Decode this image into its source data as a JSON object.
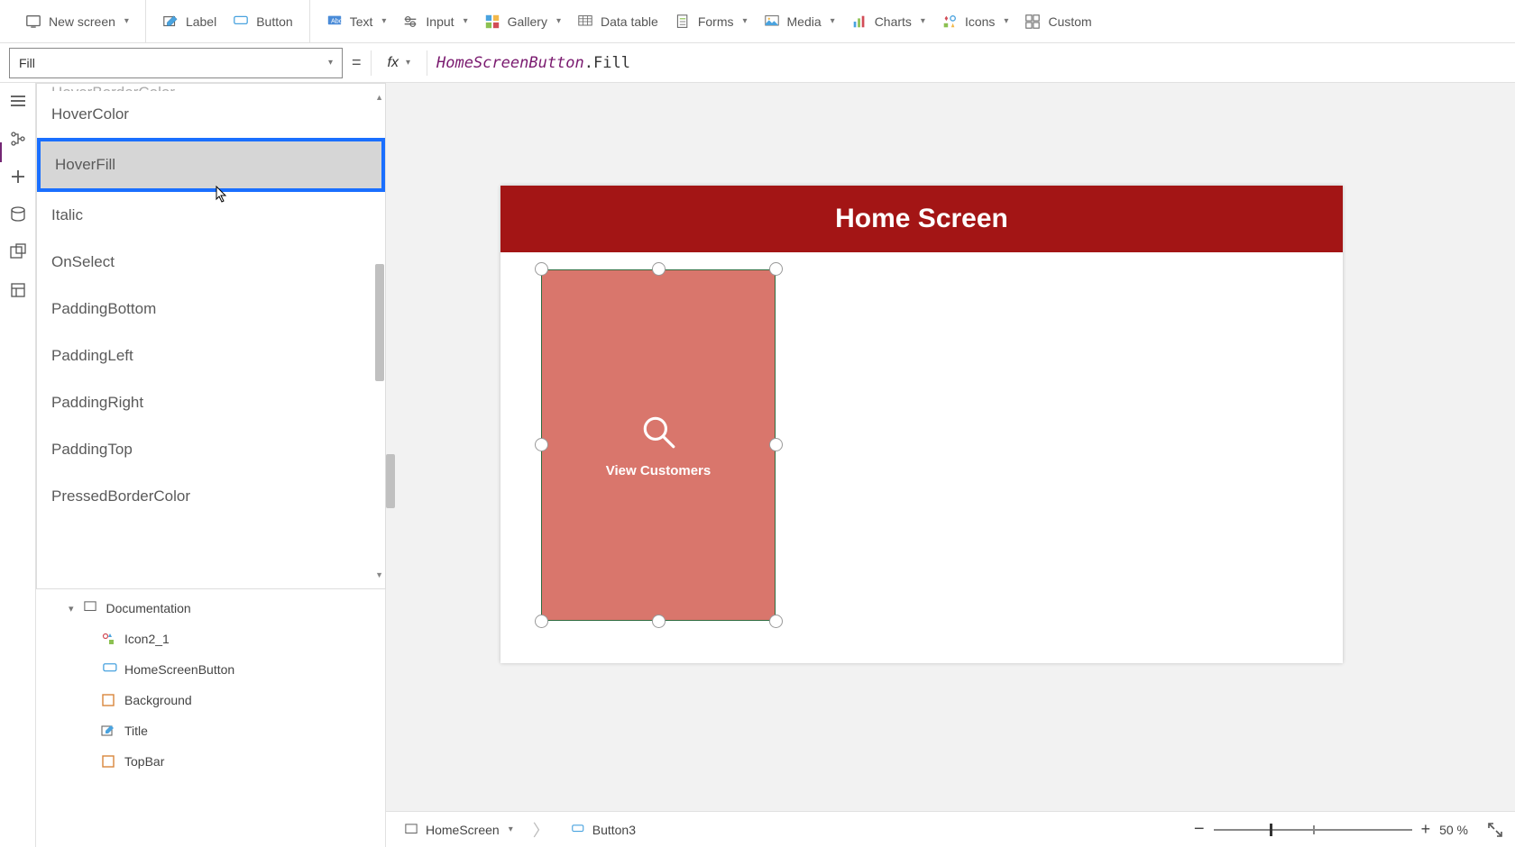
{
  "ribbon": {
    "new_screen": "New screen",
    "label": "Label",
    "button": "Button",
    "text": "Text",
    "input": "Input",
    "gallery": "Gallery",
    "data_table": "Data table",
    "forms": "Forms",
    "media": "Media",
    "charts": "Charts",
    "icons": "Icons",
    "custom": "Custom"
  },
  "formula_bar": {
    "property_selected": "Fill",
    "control_ref": "HomeScreenButton",
    "property_ref": ".Fill"
  },
  "property_dropdown": {
    "items": [
      "HoverBorderColor",
      "HoverColor",
      "HoverFill",
      "Italic",
      "OnSelect",
      "PaddingBottom",
      "PaddingLeft",
      "PaddingRight",
      "PaddingTop",
      "PressedBorderColor"
    ],
    "highlighted": "HoverFill"
  },
  "tree": {
    "parent": "Documentation",
    "children": [
      "Icon2_1",
      "HomeScreenButton",
      "Background",
      "Title",
      "TopBar"
    ]
  },
  "canvas": {
    "screen_title": "Home Screen",
    "card_label": "View Customers"
  },
  "breadcrumb": {
    "screen": "HomeScreen",
    "control": "Button3"
  },
  "zoom": {
    "value": "50",
    "unit": " %"
  }
}
